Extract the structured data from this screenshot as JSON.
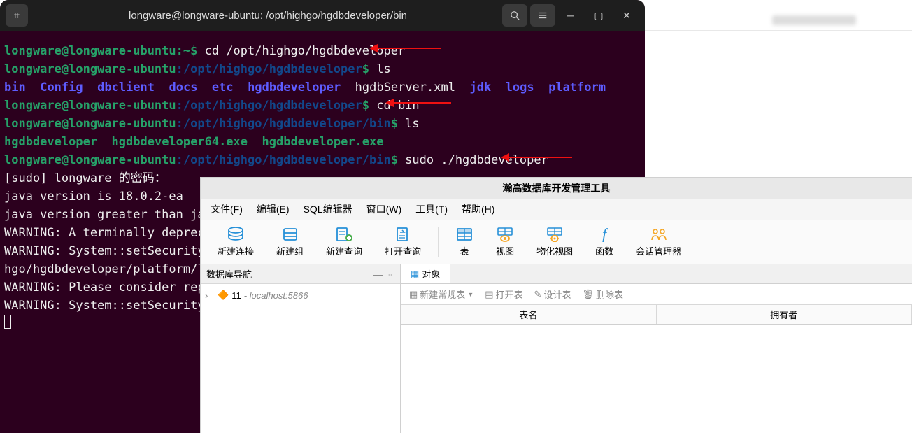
{
  "terminal": {
    "title": "longware@longware-ubuntu: /opt/highgo/hgdbdeveloper/bin",
    "user_host": "longware@longware-ubuntu",
    "home_suffix": ":~$ ",
    "path_suffix": "$ ",
    "cmds": {
      "cd1": "cd /opt/highgo/hgdbdeveloper",
      "ls": "ls",
      "cd_bin": "cd bin",
      "sudo_run": "sudo ./hgdbdeveloper"
    },
    "paths": {
      "dev": ":/opt/highgo/hgdbdeveloper",
      "bin": ":/opt/highgo/hgdbdeveloper/bin"
    },
    "ls_dirs": [
      "bin",
      "Config",
      "dbclient",
      "docs",
      "etc",
      "hgdbdeveloper",
      "jdk",
      "logs",
      "platform"
    ],
    "ls_file": "hgdbServer.xml",
    "ls_bin": [
      "hgdbdeveloper",
      "hgdbdeveloper64.exe",
      "hgdbdeveloper.exe"
    ],
    "output": {
      "sudo_pw": "[sudo] longware 的密码：",
      "jver": "java version is 18.0.2-ea",
      "jgreat": "java version greater than java ",
      "w1": "WARNING: A terminally deprecate",
      "w2": "WARNING: System::setSecurityMan",
      "w3": "hgo/hgdbdeveloper/platform/lib/",
      "w4": "WARNING: Please consider report",
      "w5": "WARNING: System::setSecurityMan"
    }
  },
  "gui": {
    "title": "瀚高数据库开发管理工具",
    "menus": [
      "文件(F)",
      "编辑(E)",
      "SQL编辑器",
      "窗口(W)",
      "工具(T)",
      "帮助(H)"
    ],
    "toolbar": {
      "new_conn": "新建连接",
      "new_group": "新建组",
      "new_query": "新建查询",
      "open_query": "打开查询",
      "table": "表",
      "view": "视图",
      "mat_view": "物化视图",
      "function": "函数",
      "session_mgr": "会话管理器"
    },
    "nav": {
      "title": "数据库导航",
      "item_num": "11",
      "item_host": " - localhost:5866"
    },
    "tab_label": "对象",
    "sub_toolbar": {
      "new_table": "新建常规表",
      "open_table": "打开表",
      "design_table": "设计表",
      "delete_table": "删除表"
    },
    "columns": {
      "table_name": "表名",
      "owner": "拥有者"
    }
  }
}
